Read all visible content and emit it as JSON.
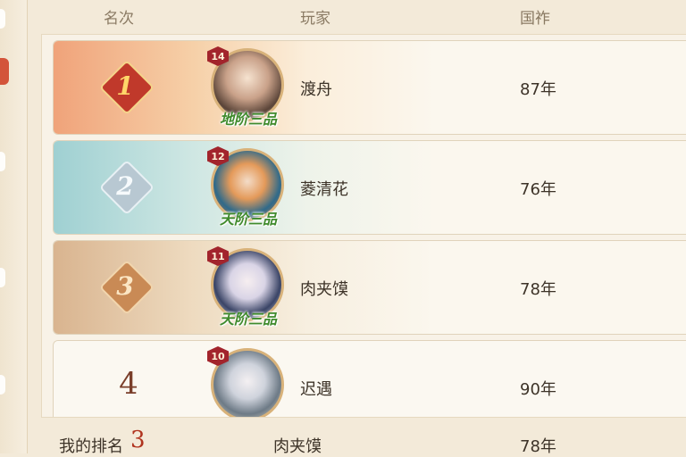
{
  "header": {
    "rank_col": "名次",
    "player_col": "玩家",
    "score_col": "国祚"
  },
  "colors": {
    "rank1": "#e8864f",
    "rank2": "#8fc6c9",
    "rank3": "#c89a6a",
    "accent_red": "#b0341f",
    "title_green": "#3f8a2c"
  },
  "rows": [
    {
      "rank": "1",
      "badge_icon": "rank-1-diamond-icon",
      "level": "14",
      "title": "地阶三品",
      "name": "渡舟",
      "score": "87年"
    },
    {
      "rank": "2",
      "badge_icon": "rank-2-diamond-icon",
      "level": "12",
      "title": "天阶三品",
      "name": "菱清花",
      "score": "76年"
    },
    {
      "rank": "3",
      "badge_icon": "rank-3-diamond-icon",
      "level": "11",
      "title": "天阶三品",
      "name": "肉夹馍",
      "score": "78年"
    },
    {
      "rank": "4",
      "badge_icon": "",
      "level": "10",
      "title": "",
      "name": "迟遇",
      "score": "90年"
    }
  ],
  "footer": {
    "my_rank_label": "我的排名",
    "my_rank_value": "3",
    "name": "肉夹馍",
    "score": "78年"
  }
}
